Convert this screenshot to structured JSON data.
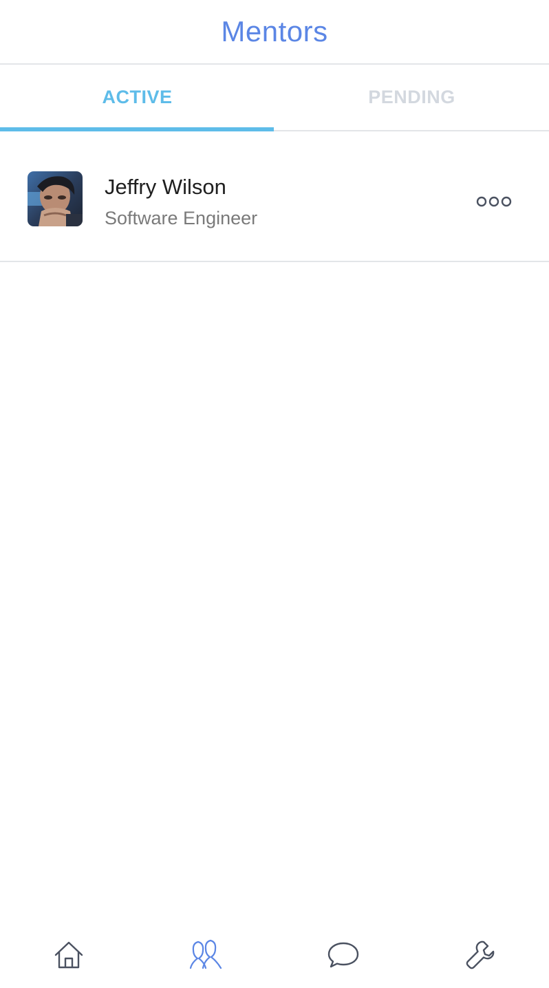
{
  "header": {
    "title": "Mentors"
  },
  "tabs": [
    {
      "label": "ACTIVE",
      "selected": true
    },
    {
      "label": "PENDING",
      "selected": false
    }
  ],
  "mentors": [
    {
      "name": "Jeffry Wilson",
      "title": "Software Engineer",
      "avatar": "person-photo",
      "menu_icon": "more-horizontal-icon"
    }
  ],
  "bottom_nav": [
    {
      "icon": "home-icon",
      "selected": false
    },
    {
      "icon": "people-icon",
      "selected": true
    },
    {
      "icon": "chat-bubble-icon",
      "selected": false
    },
    {
      "icon": "wrench-icon",
      "selected": false
    }
  ],
  "colors": {
    "accent": "#5ebce9",
    "title": "#5b86e5",
    "inactive_tab": "#d3d8df",
    "icon": "#4a5160",
    "selected_icon": "#5b86e5"
  }
}
